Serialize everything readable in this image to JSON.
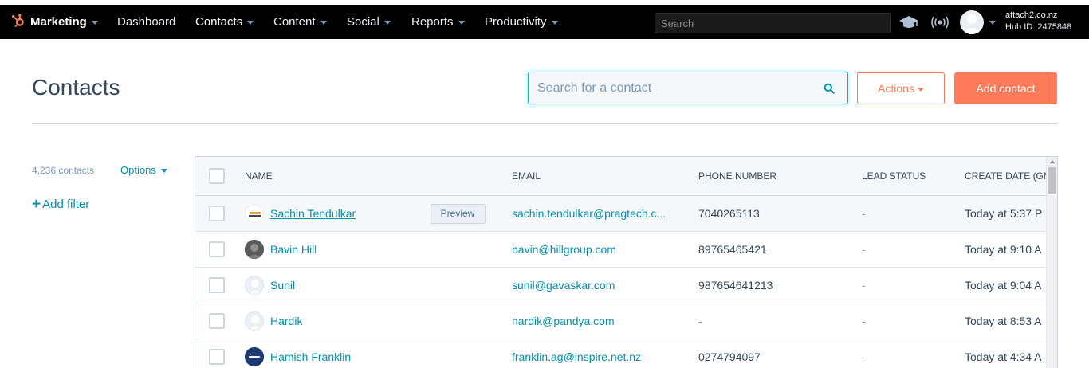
{
  "nav": {
    "brand": "Marketing",
    "items": [
      {
        "label": "Dashboard"
      },
      {
        "label": "Contacts"
      },
      {
        "label": "Content"
      },
      {
        "label": "Social"
      },
      {
        "label": "Reports"
      },
      {
        "label": "Productivity"
      }
    ],
    "search_placeholder": "Search",
    "account_name": "attach2.co.nz",
    "hub_id": "Hub ID: 2475848"
  },
  "header": {
    "title": "Contacts",
    "search_placeholder": "Search for a contact",
    "actions_label": "Actions",
    "add_contact_label": "Add contact"
  },
  "sidebar": {
    "count": "4,236 contacts",
    "options_label": "Options",
    "add_filter_label": "Add filter"
  },
  "table": {
    "columns": [
      "NAME",
      "EMAIL",
      "PHONE NUMBER",
      "LEAD STATUS",
      "CREATE DATE (GMT"
    ],
    "preview_label": "Preview",
    "rows": [
      {
        "name": "Sachin Tendulkar",
        "email": "sachin.tendulkar@pragtech.c...",
        "phone": "7040265113",
        "lead_status": "-",
        "create_date": "Today at 5:37 P",
        "avatar": "logo-avatar"
      },
      {
        "name": "Bavin Hill",
        "email": "bavin@hillgroup.com",
        "phone": "89765465421",
        "lead_status": "-",
        "create_date": "Today at 9:10 A",
        "avatar": "photo-avatar"
      },
      {
        "name": "Sunil",
        "email": "sunil@gavaskar.com",
        "phone": "987654641213",
        "lead_status": "-",
        "create_date": "Today at 9:04 A",
        "avatar": "default-avatar"
      },
      {
        "name": "Hardik",
        "email": "hardik@pandya.com",
        "phone": "-",
        "lead_status": "-",
        "create_date": "Today at 8:53 A",
        "avatar": "default-avatar"
      },
      {
        "name": "Hamish Franklin",
        "email": "franklin.ag@inspire.net.nz",
        "phone": "0274794097",
        "lead_status": "-",
        "create_date": "Today at 4:34 A",
        "avatar": "inspire-logo-avatar"
      }
    ]
  },
  "colors": {
    "accent": "#ff7a59",
    "link": "#0091ae",
    "text": "#33475b",
    "nav_bg": "#000000"
  }
}
